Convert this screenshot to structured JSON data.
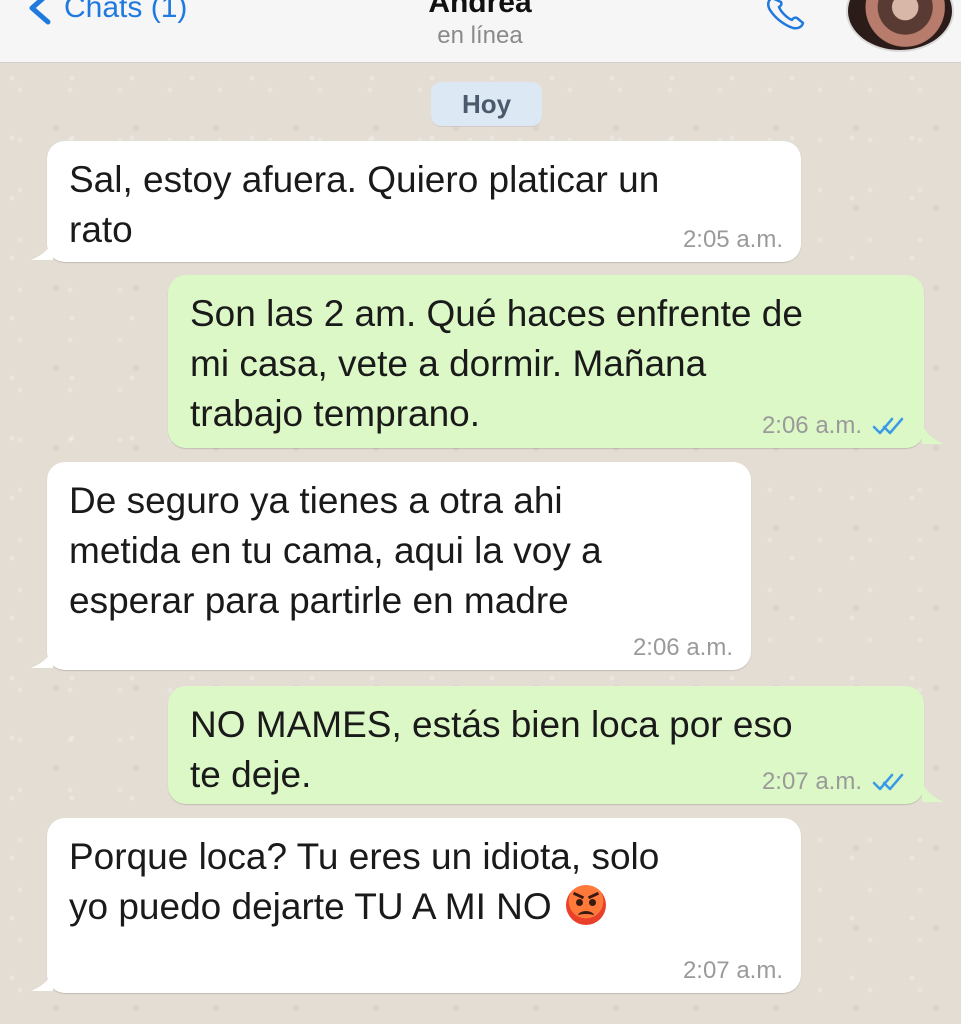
{
  "header": {
    "back_label": "Chats (1)",
    "contact_name": "Andrea",
    "contact_status": "en línea"
  },
  "date_chip": "Hoy",
  "messages": [
    {
      "direction": "incoming",
      "text": "Sal, estoy afuera. Quiero platicar un\nrato",
      "time": "2:05 a.m."
    },
    {
      "direction": "outgoing",
      "text": "Son las 2 am. Qué haces enfrente de\nmi casa, vete a dormir. Mañana\ntrabajo temprano.",
      "time": "2:06 a.m.",
      "status": "read"
    },
    {
      "direction": "incoming",
      "text": "De seguro ya tienes a otra ahi\nmetida en tu cama, aqui la voy a\nesperar para partirle en madre",
      "time": "2:06 a.m."
    },
    {
      "direction": "outgoing",
      "text": "NO MAMES, estás bien loca por eso\nte deje.",
      "time": "2:07 a.m.",
      "status": "read"
    },
    {
      "direction": "incoming",
      "text": "Porque loca? Tu eres un idiota, solo\nyo puedo dejarte TU A MI NO",
      "emoji": "angry-face-icon",
      "time": "2:07 a.m."
    }
  ],
  "colors": {
    "accent": "#1f7ae0",
    "incoming_bubble": "#ffffff",
    "outgoing_bubble": "#dcf8c6",
    "read_ticks": "#3b9ae8",
    "date_chip": "#dde8f5"
  }
}
